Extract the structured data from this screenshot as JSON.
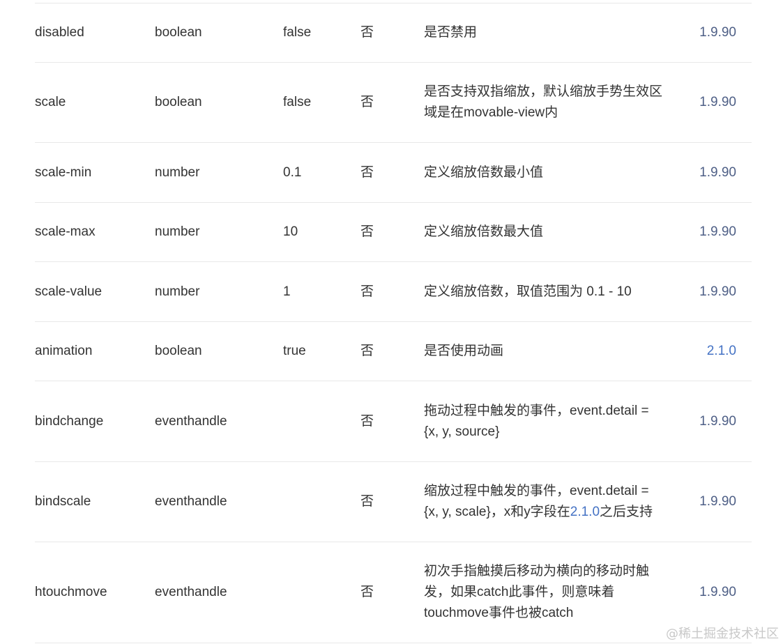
{
  "rows": [
    {
      "name": "disabled",
      "type": "boolean",
      "default": "false",
      "required": "否",
      "desc": [
        "是否禁用"
      ],
      "version": "1.9.90"
    },
    {
      "name": "scale",
      "type": "boolean",
      "default": "false",
      "required": "否",
      "desc": [
        "是否支持双指缩放，默认缩放手势生效区",
        "域是在movable-view内"
      ],
      "version": "1.9.90"
    },
    {
      "name": "scale-min",
      "type": "number",
      "default": "0.1",
      "required": "否",
      "desc": [
        "定义缩放倍数最小值"
      ],
      "version": "1.9.90"
    },
    {
      "name": "scale-max",
      "type": "number",
      "default": "10",
      "required": "否",
      "desc": [
        "定义缩放倍数最大值"
      ],
      "version": "1.9.90"
    },
    {
      "name": "scale-value",
      "type": "number",
      "default": "1",
      "required": "否",
      "desc": [
        "定义缩放倍数，取值范围为 0.1 - 10"
      ],
      "version": "1.9.90"
    },
    {
      "name": "animation",
      "type": "boolean",
      "default": "true",
      "required": "否",
      "desc": [
        "是否使用动画"
      ],
      "version": "2.1.0"
    },
    {
      "name": "bindchange",
      "type": "eventhandle",
      "default": "",
      "required": "否",
      "desc": [
        "拖动过程中触发的事件，event.detail =",
        "{x, y, source}"
      ],
      "version": "1.9.90"
    },
    {
      "name": "bindscale",
      "type": "eventhandle",
      "default": "",
      "required": "否",
      "desc": [
        "缩放过程中触发的事件，event.detail =",
        "{x, y, scale}，x和y字段在2.1.0之后支持"
      ],
      "desc_link": "2.1.0",
      "version": "1.9.90"
    },
    {
      "name": "htouchmove",
      "type": "eventhandle",
      "default": "",
      "required": "否",
      "desc": [
        "初次手指触摸后移动为横向的移动时触",
        "发，如果catch此事件，则意味着",
        "touchmove事件也被catch"
      ],
      "version": "1.9.90"
    }
  ],
  "watermark": "@稀土掘金技术社区",
  "colors": {
    "text": "#333333",
    "version": "#4e5f86",
    "link": "#4472c4",
    "border": "#e8e8e8",
    "watermark": "#c8c8c8"
  }
}
